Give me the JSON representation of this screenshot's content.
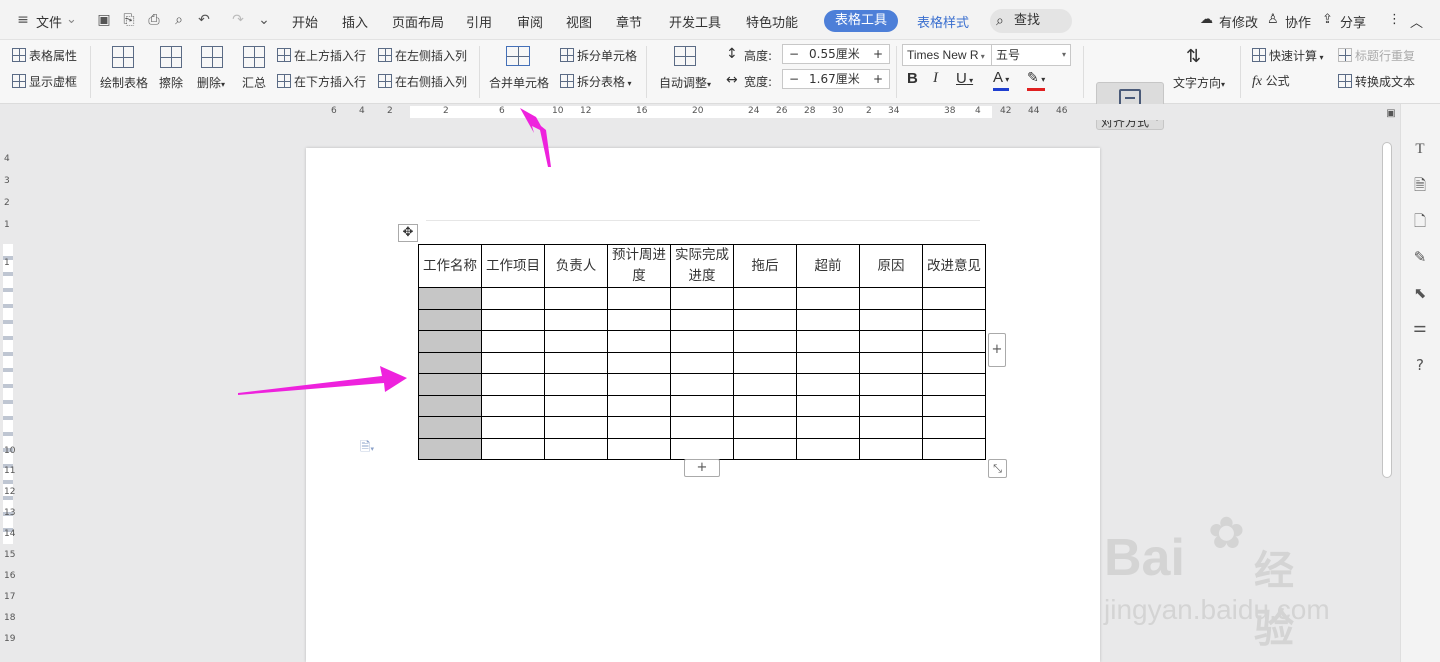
{
  "menubar": {
    "file": "文件",
    "tabs": [
      "开始",
      "插入",
      "页面布局",
      "引用",
      "审阅",
      "视图",
      "章节",
      "开发工具",
      "特色功能"
    ],
    "active_tab": "表格工具",
    "style_tab": "表格样式",
    "search": "查找",
    "modified": "有修改",
    "collab": "协作",
    "share": "分享"
  },
  "ribbon": {
    "table_props": "表格属性",
    "show_grid": "显示虚框",
    "draw_table": "绘制表格",
    "erase": "擦除",
    "delete": "删除",
    "summary": "汇总",
    "insert_above": "在上方插入行",
    "insert_below": "在下方插入行",
    "insert_left": "在左侧插入列",
    "insert_right": "在右侧插入列",
    "merge": "合并单元格",
    "split_cells": "拆分单元格",
    "split_table": "拆分表格",
    "auto_fit": "自动调整",
    "height_label": "高度:",
    "height_value": "0.55厘米",
    "width_label": "宽度:",
    "width_value": "1.67厘米",
    "font": "Times New R",
    "size": "五号",
    "align": "对齐方式",
    "text_dir": "文字方向",
    "quick_calc": "快速计算",
    "repeat_header": "标题行重复",
    "formula": "公式",
    "to_text": "转换成文本"
  },
  "ruler_numbers": [
    "6",
    "4",
    "2",
    "2",
    "6",
    "10",
    "12",
    "16",
    "20",
    "24",
    "26",
    "28",
    "30",
    "2",
    "34",
    "38",
    "4",
    "42",
    "44",
    "46"
  ],
  "vruler_numbers": [
    "4",
    "3",
    "2",
    "1",
    "1",
    "10",
    "11",
    "12",
    "13",
    "14",
    "15",
    "16",
    "17",
    "18",
    "19"
  ],
  "table": {
    "headers": [
      "工作名称",
      "工作项目",
      "负责人",
      "预计周进度",
      "实际完成进度",
      "拖后",
      "超前",
      "原因",
      "改进意见"
    ]
  },
  "colors": {
    "accent": "#4d7fd8",
    "arrow": "#ee22dd"
  },
  "watermark": {
    "brand": "Bai",
    "brand_cn": "经验",
    "url": "jingyan.baidu.com"
  }
}
